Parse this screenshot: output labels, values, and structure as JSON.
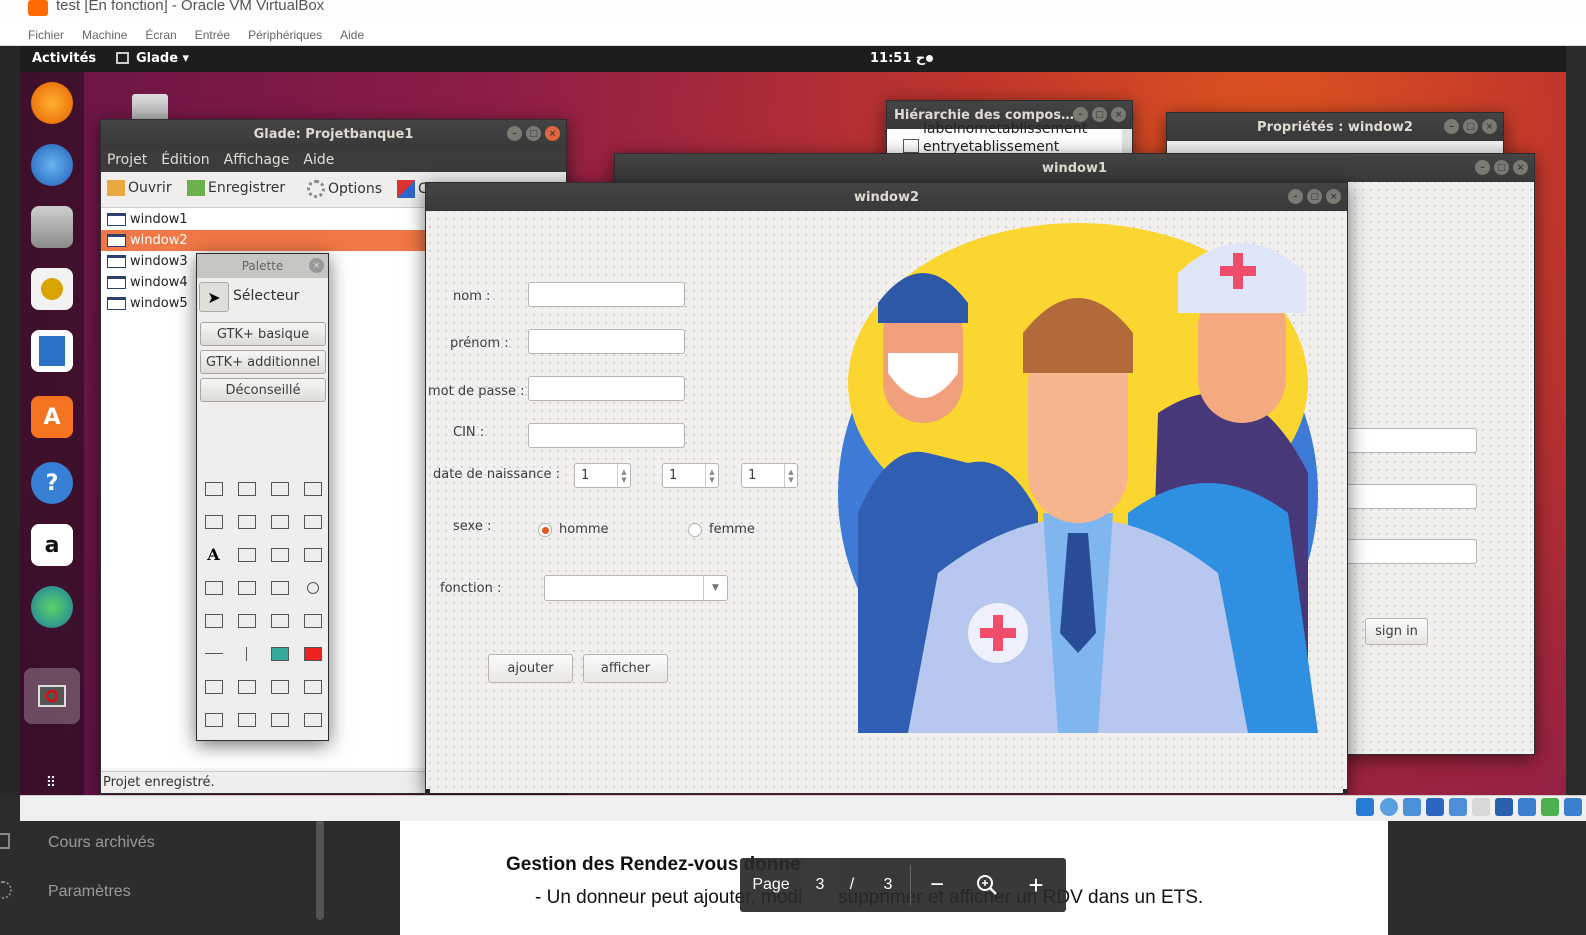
{
  "host": {
    "sidebar_items": [
      "Cours archivés",
      "Paramètres"
    ],
    "pdf": {
      "heading": "Gestion des Rendez-vous donneurs",
      "bullet": "- Un donneur peut ajouter, modifier, supprimer et afficher un RDV dans un ETS.",
      "page_label": "Page",
      "page_current": "3",
      "page_sep": "/",
      "page_total": "3"
    }
  },
  "vbox": {
    "title": "test [En fonction] - Oracle VM VirtualBox",
    "menu": [
      "Fichier",
      "Machine",
      "Écran",
      "Entrée",
      "Périphériques",
      "Aide"
    ]
  },
  "ubuntu": {
    "activities": "Activités",
    "app_menu": "Glade ▾",
    "clock": "11:51 ح",
    "dock_icons": [
      "firefox-icon",
      "thunderbird-icon",
      "files-icon",
      "rhythmbox-icon",
      "writer-icon",
      "software-icon",
      "help-icon",
      "amazon-icon",
      "globe-icon",
      "blocked-app-icon",
      "show-apps-icon"
    ]
  },
  "glade": {
    "title": "Glade: Projetbanque1",
    "menu": [
      "Projet",
      "Édition",
      "Affichage",
      "Aide"
    ],
    "toolbar": {
      "open": "Ouvrir",
      "save": "Enregistrer",
      "options": "Options",
      "more": "C"
    },
    "windows": [
      "window1",
      "window2",
      "window3",
      "window4",
      "window5"
    ],
    "selected_window": "window2",
    "status": "Projet enregistré."
  },
  "palette": {
    "title": "Palette",
    "selector": "Sélecteur",
    "groups": [
      "GTK+ basique",
      "GTK+ additionnel",
      "Déconseillé"
    ]
  },
  "hierarchy": {
    "title": "Hiérarchie des compos…",
    "rows": [
      "labelnometablissement",
      "entryetablissement"
    ]
  },
  "properties": {
    "title": "Propriétés : window2"
  },
  "window1": {
    "title": "window1",
    "signin": "sign in"
  },
  "window2": {
    "title": "window2",
    "labels": {
      "nom": "nom :",
      "prenom": "prénom :",
      "mdp": "mot de passe :",
      "cin": "CIN :",
      "date": "date de naissance :",
      "sexe": "sexe :",
      "fonction": "fonction :"
    },
    "spin_values": [
      "1",
      "1",
      "1"
    ],
    "radio": {
      "homme": "homme",
      "femme": "femme",
      "selected": "homme"
    },
    "buttons": {
      "add": "ajouter",
      "show": "afficher"
    }
  },
  "colors": {
    "accent": "#e95420",
    "illustration_sun": "#fbd530",
    "illustration_circle": "#3e7bd6"
  }
}
